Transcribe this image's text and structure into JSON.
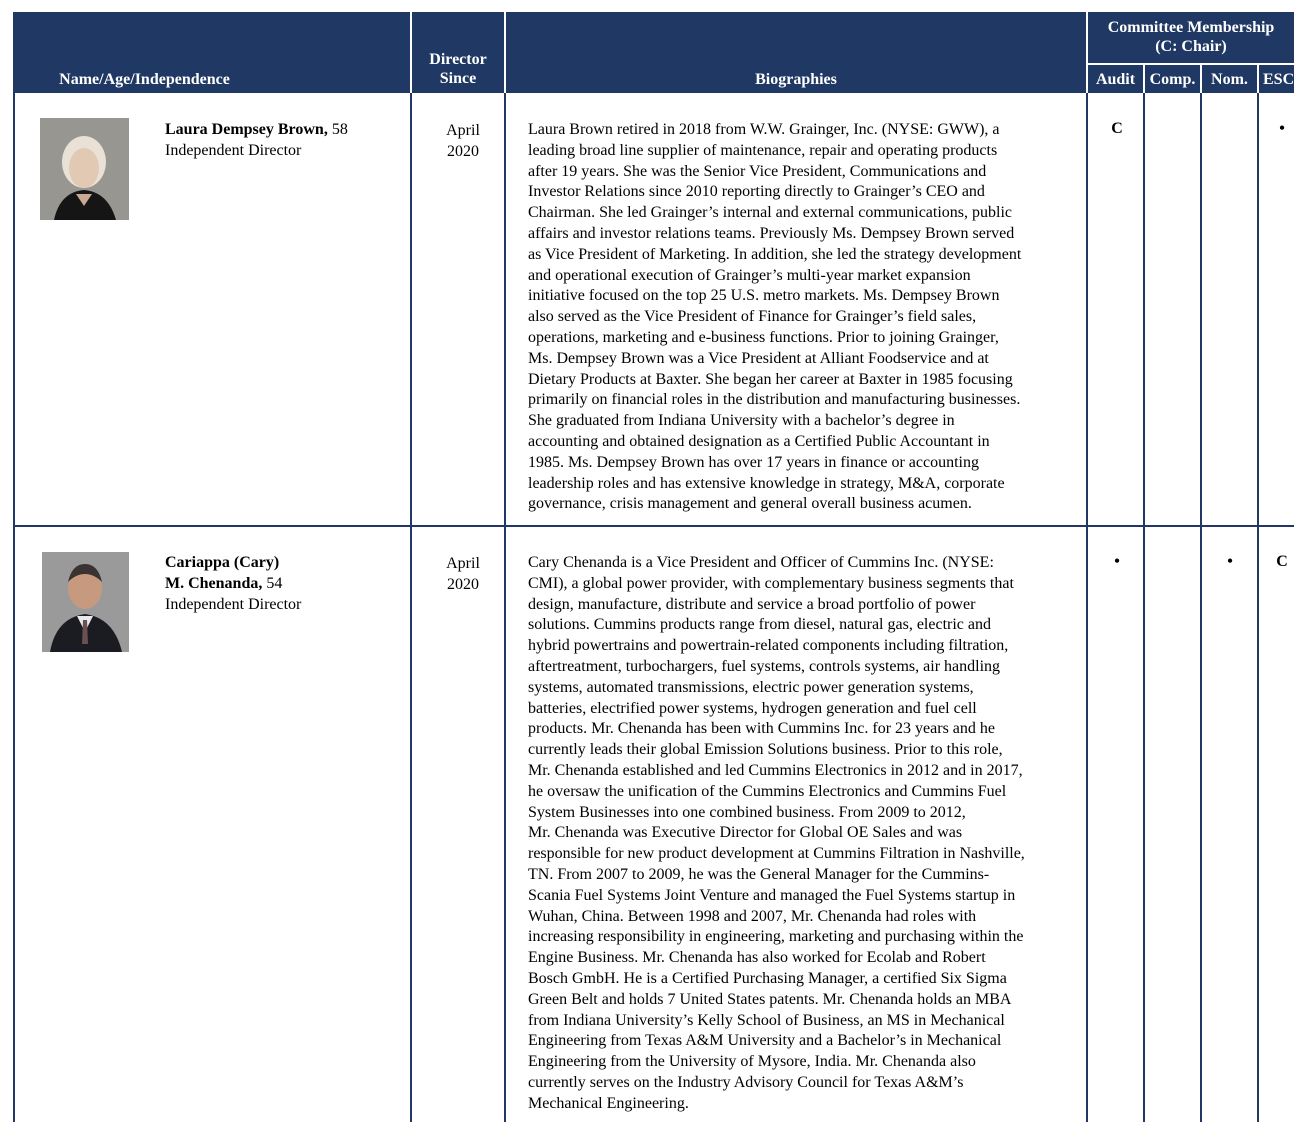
{
  "header": {
    "name_col": "Name/Age/Independence",
    "director_since": [
      "Director",
      "Since"
    ],
    "biographies": "Biographies",
    "committee": [
      "Committee Membership",
      "(C: Chair)"
    ],
    "committees": [
      "Audit",
      "Comp.",
      "Nom.",
      "ESC"
    ]
  },
  "directors": [
    {
      "name": "Laura Dempsey Brown,",
      "age": "58",
      "independence": "Independent Director",
      "since": [
        "April",
        "2020"
      ],
      "bio": [
        "Laura Brown retired in 2018 from W.W. Grainger, Inc. (NYSE: GWW), a",
        "leading broad line supplier of maintenance, repair and operating products",
        "after 19 years. She was the Senior Vice President, Communications and",
        "Investor Relations since 2010 reporting directly to Grainger’s CEO and",
        "Chairman. She led Grainger’s internal and external communications, public",
        "affairs and investor relations teams. Previously Ms. Dempsey Brown served",
        "as Vice President of Marketing. In addition, she led the strategy development",
        "and operational execution of Grainger’s multi-year market expansion",
        "initiative focused on the top 25 U.S. metro markets. Ms. Dempsey Brown",
        "also served as the Vice President of Finance for Grainger’s field sales,",
        "operations, marketing and e-business functions. Prior to joining Grainger,",
        "Ms. Dempsey Brown was a Vice President at Alliant Foodservice and at",
        "Dietary Products at Baxter. She began her career at Baxter in 1985 focusing",
        "primarily on financial roles in the distribution and manufacturing businesses.",
        "She graduated from Indiana University with a bachelor’s degree in",
        "accounting and obtained designation as a Certified Public Accountant in",
        "1985. Ms. Dempsey Brown has over 17 years in finance or accounting",
        "leadership roles and has extensive knowledge in strategy, M&A, corporate",
        "governance, crisis management and general overall business acumen."
      ],
      "marks": {
        "audit": "C",
        "comp": "",
        "nom": "",
        "esc": "•"
      }
    },
    {
      "name_line1": "Cariappa (Cary)",
      "name": "M. Chenanda,",
      "age": "54",
      "independence": "Independent Director",
      "since": [
        "April",
        "2020"
      ],
      "bio": [
        "Cary Chenanda is a Vice President and Officer of Cummins Inc. (NYSE:",
        "CMI), a global power provider, with complementary business segments that",
        "design, manufacture, distribute and service a broad portfolio of power",
        "solutions. Cummins products range from diesel, natural gas, electric and",
        "hybrid powertrains and powertrain-related components including filtration,",
        "aftertreatment, turbochargers, fuel systems, controls systems, air handling",
        "systems, automated transmissions, electric power generation systems,",
        "batteries, electrified power systems, hydrogen generation and fuel cell",
        "products. Mr. Chenanda has been with Cummins Inc. for 23 years and he",
        "currently leads their global Emission Solutions business. Prior to this role,",
        "Mr. Chenanda established and led Cummins Electronics in 2012 and in 2017,",
        "he oversaw the unification of the Cummins Electronics and Cummins Fuel",
        "System Businesses into one combined business. From 2009 to 2012,",
        "Mr. Chenanda was Executive Director for Global OE Sales and was",
        "responsible for new product development at Cummins Filtration in Nashville,",
        "TN. From 2007 to 2009, he was the General Manager for the Cummins-",
        "Scania Fuel Systems Joint Venture and managed the Fuel Systems startup in",
        "Wuhan, China. Between 1998 and 2007, Mr. Chenanda had roles with",
        "increasing responsibility in engineering, marketing and purchasing within the",
        "Engine Business. Mr. Chenanda has also worked for Ecolab and Robert",
        "Bosch GmbH. He is a Certified Purchasing Manager, a certified Six Sigma",
        "Green Belt and holds 7 United States patents. Mr. Chenanda holds an MBA",
        "from Indiana University’s Kelly School of Business, an MS in Mechanical",
        "Engineering from Texas A&M University and a Bachelor’s in Mechanical",
        "Engineering from the University of Mysore, India. Mr. Chenanda also",
        "currently serves on the Industry Advisory Council for Texas A&M’s",
        "Mechanical Engineering."
      ],
      "marks": {
        "audit": "•",
        "comp": "",
        "nom": "•",
        "esc": "C"
      }
    }
  ]
}
